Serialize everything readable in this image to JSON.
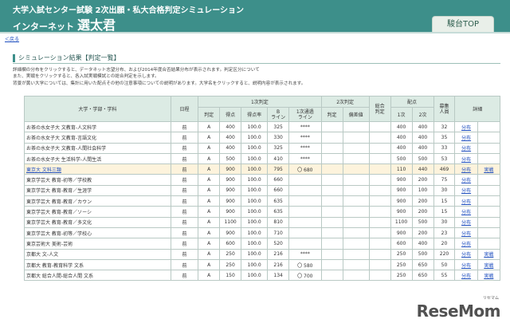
{
  "header": {
    "line1": "大学入試センター試験 2次出願・私大合格判定シミュレーション",
    "net": "インターネット",
    "brand": "選太君",
    "tab": "駿台TOP"
  },
  "back": "＜戻る",
  "section": {
    "title": "シミュレーション結果【判定一覧】"
  },
  "description": [
    "詳細欄の分布をクリックすると、データネット志望分布、および2014年度合否結果分布が表示されます。判定区分について",
    "また、実戦をクリックすると、各入試実戦模試との総合判定を示します。",
    "背景が黄い大学については、集計に用いた配点その他の注意事項についての説明があります。大学名をクリックすると、説明内容が表示されます。"
  ],
  "table": {
    "headers": {
      "name": "大学・学部・学科",
      "sched": "日程",
      "group1": "1次判定",
      "judge": "判定",
      "score": "得点",
      "rate": "得点率",
      "bline": "B\nライン",
      "pass1": "1次通過\nライン",
      "group2": "2次判定",
      "judge2": "判定",
      "dev": "偏差値",
      "total": "総合\n判定",
      "group_points": "配点",
      "p1": "1次",
      "p2": "2次",
      "capacity": "募集\n人員",
      "detail": "詳細"
    },
    "rows": [
      {
        "name": "お茶の水女子大 文教育-人文科学",
        "sched": "前",
        "judge": "A",
        "score": "400",
        "rate": "100.0",
        "bline": "325",
        "pass1": "****",
        "judge2": "",
        "dev": "",
        "total": "",
        "p1": "400",
        "p2": "400",
        "cap": "32",
        "d1": "分布",
        "d2": "",
        "hl": false
      },
      {
        "name": "お茶の水女子大 文教育-言語文化",
        "sched": "前",
        "judge": "A",
        "score": "400",
        "rate": "100.0",
        "bline": "330",
        "pass1": "****",
        "judge2": "",
        "dev": "",
        "total": "",
        "p1": "400",
        "p2": "400",
        "cap": "35",
        "d1": "分布",
        "d2": "",
        "hl": false
      },
      {
        "name": "お茶の水女子大 文教育-人間社会科学",
        "sched": "前",
        "judge": "A",
        "score": "400",
        "rate": "100.0",
        "bline": "325",
        "pass1": "****",
        "judge2": "",
        "dev": "",
        "total": "",
        "p1": "400",
        "p2": "400",
        "cap": "33",
        "d1": "分布",
        "d2": "",
        "hl": false
      },
      {
        "name": "お茶の水女子大 生活科学-人間生活",
        "sched": "前",
        "judge": "A",
        "score": "500",
        "rate": "100.0",
        "bline": "410",
        "pass1": "****",
        "judge2": "",
        "dev": "",
        "total": "",
        "p1": "500",
        "p2": "500",
        "cap": "53",
        "d1": "分布",
        "d2": "",
        "hl": false
      },
      {
        "name": "東京大 文科三類",
        "sched": "前",
        "judge": "A",
        "score": "900",
        "rate": "100.0",
        "bline": "795",
        "pass1": "〇 680",
        "judge2": "",
        "dev": "",
        "total": "",
        "p1": "110",
        "p2": "440",
        "cap": "469",
        "d1": "分布",
        "d2": "実戦",
        "hl": true
      },
      {
        "name": "東京学芸大 教育-初等／学校教",
        "sched": "前",
        "judge": "A",
        "score": "900",
        "rate": "100.0",
        "bline": "660",
        "pass1": "",
        "judge2": "",
        "dev": "",
        "total": "",
        "p1": "900",
        "p2": "200",
        "cap": "75",
        "d1": "分布",
        "d2": "",
        "hl": false
      },
      {
        "name": "東京学芸大 教育-教育／生涯学",
        "sched": "前",
        "judge": "A",
        "score": "900",
        "rate": "100.0",
        "bline": "660",
        "pass1": "",
        "judge2": "",
        "dev": "",
        "total": "",
        "p1": "900",
        "p2": "100",
        "cap": "30",
        "d1": "分布",
        "d2": "",
        "hl": false
      },
      {
        "name": "東京学芸大 教育-教育／カウン",
        "sched": "前",
        "judge": "A",
        "score": "900",
        "rate": "100.0",
        "bline": "635",
        "pass1": "",
        "judge2": "",
        "dev": "",
        "total": "",
        "p1": "900",
        "p2": "200",
        "cap": "15",
        "d1": "分布",
        "d2": "",
        "hl": false
      },
      {
        "name": "東京学芸大 教育-教育／ソーシ",
        "sched": "前",
        "judge": "A",
        "score": "900",
        "rate": "100.0",
        "bline": "635",
        "pass1": "",
        "judge2": "",
        "dev": "",
        "total": "",
        "p1": "900",
        "p2": "200",
        "cap": "15",
        "d1": "分布",
        "d2": "",
        "hl": false
      },
      {
        "name": "東京学芸大 教育-教育／多文化",
        "sched": "前",
        "judge": "A",
        "score": "1100",
        "rate": "100.0",
        "bline": "810",
        "pass1": "",
        "judge2": "",
        "dev": "",
        "total": "",
        "p1": "1100",
        "p2": "500",
        "cap": "30",
        "d1": "分布",
        "d2": "",
        "hl": false
      },
      {
        "name": "東京学芸大 教育-初等／学校心",
        "sched": "前",
        "judge": "A",
        "score": "900",
        "rate": "100.0",
        "bline": "710",
        "pass1": "",
        "judge2": "",
        "dev": "",
        "total": "",
        "p1": "900",
        "p2": "200",
        "cap": "23",
        "d1": "分布",
        "d2": "",
        "hl": false
      },
      {
        "name": "東京芸術大 美術-芸術",
        "sched": "前",
        "judge": "A",
        "score": "600",
        "rate": "100.0",
        "bline": "520",
        "pass1": "",
        "judge2": "",
        "dev": "",
        "total": "",
        "p1": "600",
        "p2": "400",
        "cap": "20",
        "d1": "分布",
        "d2": "",
        "hl": false
      },
      {
        "name": "京都大 文-人文",
        "sched": "前",
        "judge": "A",
        "score": "250",
        "rate": "100.0",
        "bline": "216",
        "pass1": "****",
        "judge2": "",
        "dev": "",
        "total": "",
        "p1": "250",
        "p2": "500",
        "cap": "220",
        "d1": "分布",
        "d2": "実戦",
        "hl": false
      },
      {
        "name": "京都大 教育-教育科学 文系",
        "sched": "前",
        "judge": "A",
        "score": "250",
        "rate": "100.0",
        "bline": "216",
        "pass1": "〇 580",
        "judge2": "",
        "dev": "",
        "total": "",
        "p1": "250",
        "p2": "650",
        "cap": "50",
        "d1": "分布",
        "d2": "実戦",
        "hl": false
      },
      {
        "name": "京都大 総合人間-総合人間 文系",
        "sched": "前",
        "judge": "A",
        "score": "150",
        "rate": "100.0",
        "bline": "134",
        "pass1": "〇 700",
        "judge2": "",
        "dev": "",
        "total": "",
        "p1": "250",
        "p2": "650",
        "cap": "55",
        "d1": "分布",
        "d2": "実戦",
        "hl": false
      }
    ]
  },
  "watermark": {
    "text": "ReseMom",
    "sub": "リセマム"
  },
  "colors": {
    "header_bg": "#3d8f8a",
    "table_header_bg": "#dcebe4",
    "highlight_row": "#fdf3dc",
    "link": "#1f4fbf"
  }
}
